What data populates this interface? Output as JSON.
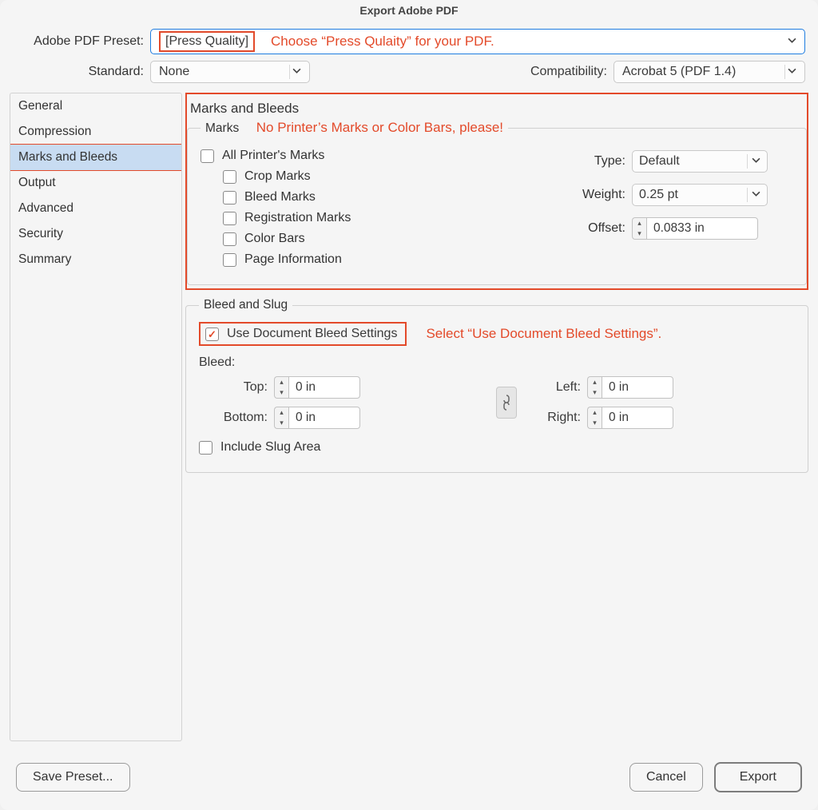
{
  "window": {
    "title": "Export Adobe PDF"
  },
  "header": {
    "preset_label": "Adobe PDF Preset:",
    "preset_value": "[Press Quality]",
    "preset_annotation": "Choose “Press Qulaity” for your PDF.",
    "standard_label": "Standard:",
    "standard_value": "None",
    "compat_label": "Compatibility:",
    "compat_value": "Acrobat 5 (PDF 1.4)"
  },
  "sidebar": {
    "items": [
      "General",
      "Compression",
      "Marks and Bleeds",
      "Output",
      "Advanced",
      "Security",
      "Summary"
    ],
    "selected_index": 2
  },
  "panel": {
    "title": "Marks and Bleeds",
    "marks": {
      "legend": "Marks",
      "annotation": "No Printer’s Marks or Color Bars, please!",
      "all_printers_marks": "All Printer's Marks",
      "crop_marks": "Crop Marks",
      "bleed_marks": "Bleed Marks",
      "registration_marks": "Registration Marks",
      "color_bars": "Color Bars",
      "page_information": "Page Information",
      "type_label": "Type:",
      "type_value": "Default",
      "weight_label": "Weight:",
      "weight_value": "0.25 pt",
      "offset_label": "Offset:",
      "offset_value": "0.0833 in"
    },
    "bleed": {
      "legend": "Bleed and Slug",
      "use_doc_bleed": "Use Document Bleed Settings",
      "use_doc_bleed_annot": "Select “Use Document Bleed Settings”.",
      "bleed_heading": "Bleed:",
      "top_label": "Top:",
      "top_value": "0 in",
      "bottom_label": "Bottom:",
      "bottom_value": "0 in",
      "left_label": "Left:",
      "left_value": "0 in",
      "right_label": "Right:",
      "right_value": "0 in",
      "include_slug": "Include Slug Area"
    }
  },
  "footer": {
    "save_preset": "Save Preset...",
    "cancel": "Cancel",
    "export": "Export"
  }
}
